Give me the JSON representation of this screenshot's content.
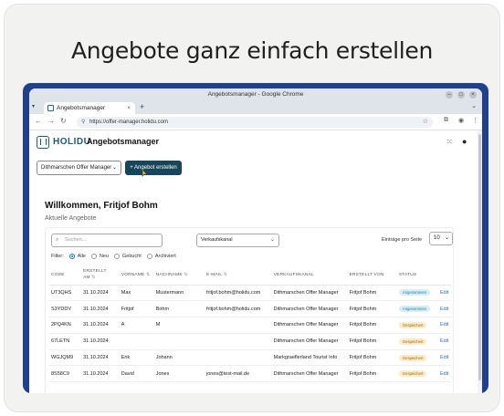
{
  "headline": "Angebote ganz einfach erstellen",
  "browser": {
    "window_title": "Angebotsmanager - Google Chrome",
    "tab_title": "Angebotsmanager",
    "url": "https://offer-manager.holidu.com"
  },
  "app": {
    "brand": "HOLIDU",
    "title": "Angebotsmanager",
    "manager_select": "Dithmarschen Offer Manager",
    "create_button": "+ Angebot erstellen",
    "welcome": "Willkommen, Fritjof Bohm",
    "subtitle": "Aktuelle Angebote",
    "search_placeholder": "Suchen...",
    "channel_select": "Verkaufskanal",
    "per_page_label": "Einträge pro Seite",
    "per_page_value": "10",
    "filter": {
      "label": "Filter:",
      "options": [
        "Alle",
        "Neu",
        "Gebucht",
        "Archiviert"
      ],
      "selected": "Alle"
    },
    "table": {
      "headers": {
        "code": "CODE",
        "created_at_1": "ERSTELLT",
        "created_at_2": "AM",
        "firstname": "VORNAME",
        "lastname": "NACHNAME",
        "email": "E-MAIL",
        "channel": "VERKAUFSKANAL",
        "created_by": "ERSTELLT VON",
        "status": "STATUS"
      },
      "rows": [
        {
          "code": "UT3QHS",
          "date": "31.10.2024",
          "first": "Max",
          "last": "Mustermann",
          "email": "fritjof.bohm@holidu.com",
          "channel": "Dithmarschen Offer Manager",
          "by": "Fritjof Bohm",
          "status": "Angenommen",
          "kind": "accepted",
          "action": "Edit"
        },
        {
          "code": "S3YDDV",
          "date": "31.10.2024",
          "first": "Fritjof",
          "last": "Bohm",
          "email": "fritjof.bohm@holidu.com",
          "channel": "Dithmarschen Offer Manager",
          "by": "Fritjof Bohm",
          "status": "Angenommen",
          "kind": "accepted",
          "action": "Edit"
        },
        {
          "code": "2PQ4KN",
          "date": "31.10.2024",
          "first": "A",
          "last": "M",
          "email": "",
          "channel": "Dithmarschen Offer Manager",
          "by": "Fritjof Bohm",
          "status": "Gespeichert",
          "kind": "saved",
          "action": "Edit"
        },
        {
          "code": "67LETN",
          "date": "31.10.2024",
          "first": "",
          "last": "",
          "email": "",
          "channel": "Dithmarschen Offer Manager",
          "by": "Fritjof Bohm",
          "status": "Gespeichert",
          "kind": "saved",
          "action": "Edit"
        },
        {
          "code": "WGJQM9",
          "date": "31.10.2024",
          "first": "Erik",
          "last": "Johann",
          "email": "",
          "channel": "Markgraeflerland Tourist Info",
          "by": "Fritjof Bohm",
          "status": "Gespeichert",
          "kind": "saved",
          "action": "Edit"
        },
        {
          "code": "8S58C9",
          "date": "31.10.2024",
          "first": "David",
          "last": "Jones",
          "email": "jones@test-mail.de",
          "channel": "Dithmarschen Offer Manager",
          "by": "Fritjof Bohm",
          "status": "Gespeichert",
          "kind": "saved",
          "action": "Edit"
        }
      ]
    }
  },
  "colors": {
    "frame": "#1f3f8f",
    "primary": "#17465a",
    "accent": "#1a5d6f"
  }
}
